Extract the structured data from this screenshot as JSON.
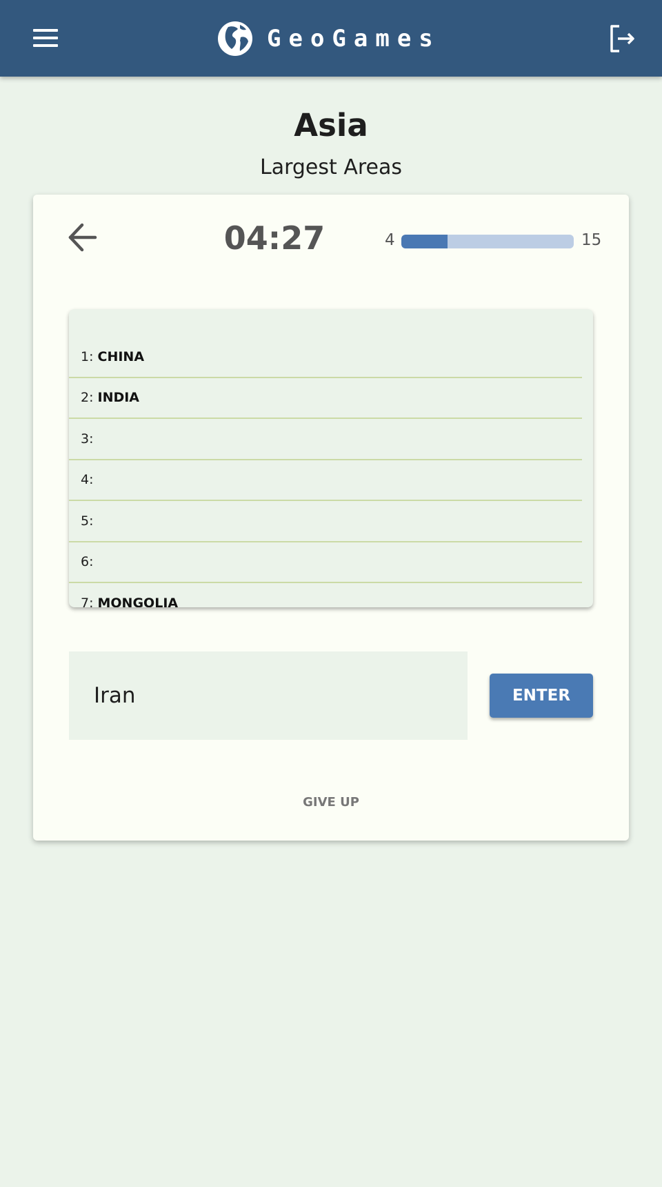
{
  "header": {
    "brand_name": "GeoGames",
    "icons": {
      "menu": "hamburger-menu-icon",
      "logo": "globe-icon",
      "logout": "logout-icon"
    },
    "color": "#33587e"
  },
  "quiz": {
    "title": "Asia",
    "subtitle": "Largest Areas"
  },
  "game": {
    "back_icon": "arrow-left-icon",
    "timer": "04:27",
    "progress": {
      "current": "4",
      "total": "15",
      "fraction": 0.267,
      "fill_color": "#4a78b3",
      "track_color": "#bccde4"
    },
    "answers": [
      {
        "number": "1:",
        "name": "CHINA"
      },
      {
        "number": "2:",
        "name": "INDIA"
      },
      {
        "number": "3:",
        "name": ""
      },
      {
        "number": "4:",
        "name": ""
      },
      {
        "number": "5:",
        "name": ""
      },
      {
        "number": "6:",
        "name": ""
      },
      {
        "number": "7:",
        "name": "MONGOLIA"
      }
    ],
    "input_value": "Iran",
    "enter_label": "ENTER",
    "give_up_label": "GIVE UP",
    "accent_color": "#4a7ab4"
  }
}
